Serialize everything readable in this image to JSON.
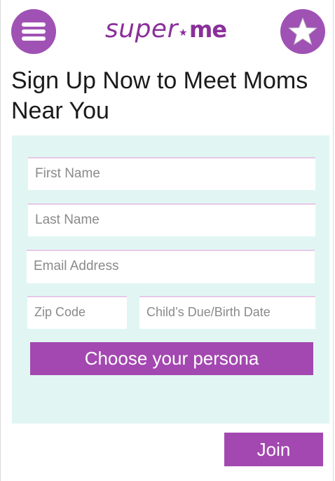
{
  "header": {
    "logo_part1": "super",
    "logo_star": "★",
    "logo_part2": "me",
    "menu_icon": "hamburger-menu-icon",
    "star_icon": "star-icon"
  },
  "page": {
    "title": "Sign Up Now to Meet Moms Near You"
  },
  "form": {
    "first_name_placeholder": "First Name",
    "last_name_placeholder": "Last Name",
    "email_placeholder": "Email Address",
    "zip_placeholder": "Zip Code",
    "birth_date_placeholder": "Child’s Due/Birth Date",
    "persona_button": "Choose your persona"
  },
  "actions": {
    "join_button": "Join"
  },
  "colors": {
    "accent": "#a348b0",
    "panel": "#e1f6f3",
    "field_top_border": "#e6c9e8"
  }
}
